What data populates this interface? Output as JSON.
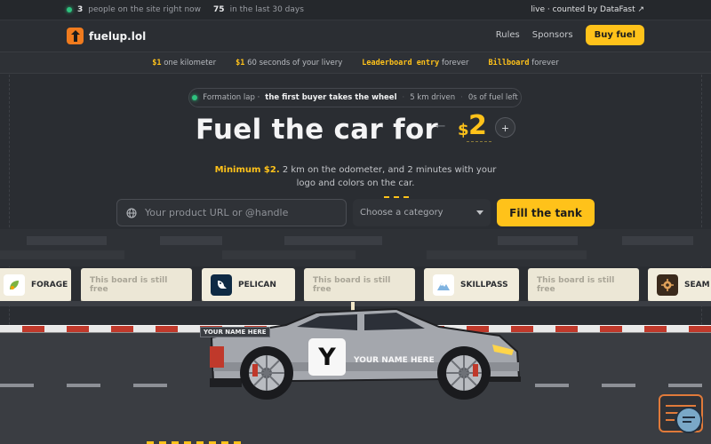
{
  "topbar": {
    "online_count": "3",
    "online_text": "people on the site right now",
    "month_count": "75",
    "month_text": "in the last 30 days",
    "right_text": "live · counted by DataFast ↗"
  },
  "nav": {
    "brand": "fuelup.lol",
    "links": [
      "Rules",
      "Sponsors"
    ],
    "cta": "Buy fuel"
  },
  "prices": [
    {
      "hl": "$1",
      "text": "one kilometer"
    },
    {
      "hl": "$1",
      "text": "60 seconds of your livery"
    },
    {
      "hl": "Leaderboard entry",
      "text": "forever"
    },
    {
      "hl": "Billboard",
      "text": "forever"
    }
  ],
  "status_pill": {
    "lap": "Formation lap ·",
    "bold": "the first buyer takes the wheel",
    "km": "5 km driven",
    "fuel": "0s of fuel left"
  },
  "hero": {
    "headline": "Fuel the car for",
    "minus": "−",
    "currency": "$",
    "amount": "2",
    "plus": "+",
    "min_label": "Minimum $2.",
    "sub_text": "2 km on the odometer, and 2 minutes with your logo and colors on the car."
  },
  "form": {
    "url_placeholder": "Your product URL or @handle",
    "category_value": "Choose a category",
    "submit": "Fill the tank"
  },
  "boards": [
    {
      "type": "brand",
      "label": "FORAGE",
      "icon": "leaf-icon",
      "color": "#ffffff"
    },
    {
      "type": "free",
      "label": "This board is still free"
    },
    {
      "type": "brand",
      "label": "PELICAN",
      "icon": "pelican-icon",
      "color": "#0f2a44"
    },
    {
      "type": "free",
      "label": "This board is still free"
    },
    {
      "type": "brand",
      "label": "SKILLPASS",
      "icon": "mountain-icon",
      "color": "#ffffff"
    },
    {
      "type": "free",
      "label": "This board is still free"
    },
    {
      "type": "brand",
      "label": "SEAM",
      "icon": "gear-icon",
      "color": "#3b2a1c"
    }
  ],
  "car": {
    "name_small": "YOUR NAME HERE",
    "logo_letter": "Y",
    "name_large": "YOUR NAME HERE"
  },
  "colors": {
    "accent": "#ffc21a",
    "background": "#2a2d32",
    "barrier_red": "#c0392b",
    "online_dot": "#2ec27e"
  }
}
